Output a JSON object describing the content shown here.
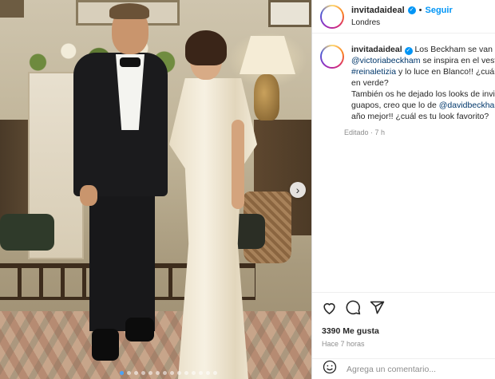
{
  "post": {
    "username": "invitadaideal",
    "follow_label": "Seguir",
    "location": "Londres",
    "separator": "•"
  },
  "caption": {
    "username": "invitadaideal",
    "line1_text": " Los Beckham se van de",
    "mention1": "@victoriabeckham",
    "line2_text": " se inspira en el vest",
    "mention2": "#reinaletizia",
    "line3_text": " y lo luce en Blanco!! ¿cuál",
    "line4": "en verde?",
    "line5": "También os he dejado los looks de invi",
    "line6_text": "guapos, creo que lo de ",
    "mention3": "@davidbeckhan",
    "line7": "año mejor!! ¿cuál es tu look favorito?",
    "meta": "Editado · 7 h"
  },
  "engagement": {
    "likes": "3390 Me gusta",
    "time_ago": "Hace 7 horas"
  },
  "comment": {
    "placeholder": "Agrega un comentario..."
  },
  "icons": [
    "heart-icon",
    "comment-icon",
    "share-icon",
    "emoji-icon",
    "next-arrow-icon",
    "verified-icon"
  ],
  "colors": {
    "accent": "#0095f6",
    "mention": "#00376b",
    "muted": "#8e8e8e"
  },
  "carousel": {
    "dots": 14,
    "active_index": 0
  }
}
